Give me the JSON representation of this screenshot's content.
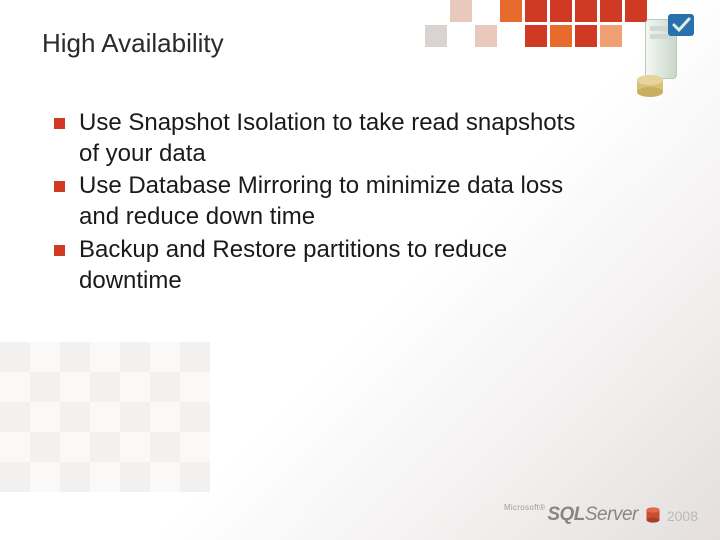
{
  "title": "High Availability",
  "bullets": [
    "Use Snapshot Isolation to take read snapshots of your data",
    "Use Database Mirroring to minimize data loss and reduce down time",
    "Backup and Restore partitions to reduce downtime"
  ],
  "logo": {
    "brand_small": "Microsoft®",
    "product_a": "SQL",
    "product_b": "Server",
    "year": "2008"
  }
}
